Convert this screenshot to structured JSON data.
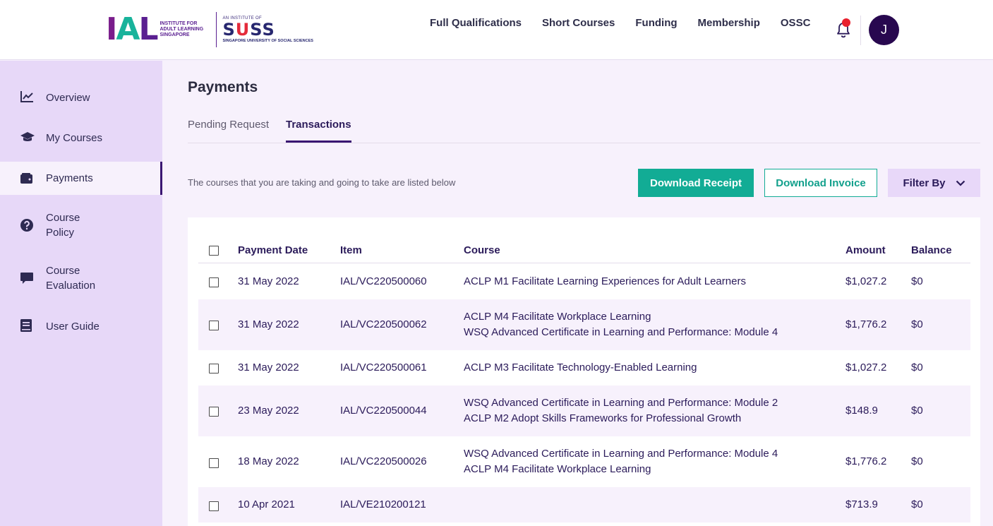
{
  "header": {
    "logo_ial_sub": "INSTITUTE FOR ADULT LEARNING SINGAPORE",
    "logo_suss_top": "AN INSTITUTE OF",
    "logo_suss_main_1": "S",
    "logo_suss_main_2": "U",
    "logo_suss_main_3": "SS",
    "logo_suss_bottom": "SINGAPORE UNIVERSITY OF SOCIAL SCIENCES",
    "nav": [
      "Full Qualifications",
      "Short Courses",
      "Funding",
      "Membership",
      "OSSC"
    ],
    "avatar_initial": "J"
  },
  "sidebar": {
    "items": [
      {
        "label": "Overview",
        "icon": "chart-line-icon"
      },
      {
        "label": "My Courses",
        "icon": "graduation-cap-icon"
      },
      {
        "label": "Payments",
        "icon": "wallet-icon",
        "active": true
      },
      {
        "label": "Course Policy",
        "label_1": "Course",
        "label_2": "Policy",
        "icon": "question-circle-icon"
      },
      {
        "label": "Course Evaluation",
        "label_1": "Course",
        "label_2": "Evaluation",
        "icon": "comment-icon"
      },
      {
        "label": "User Guide",
        "icon": "book-icon"
      }
    ]
  },
  "main": {
    "title": "Payments",
    "tabs": [
      {
        "label": "Pending Request",
        "active": false
      },
      {
        "label": "Transactions",
        "active": true
      }
    ],
    "description": "The courses that you are taking and going to take are listed below",
    "buttons": {
      "download_receipt": "Download Receipt",
      "download_invoice": "Download Invoice",
      "filter_by": "Filter By"
    },
    "table": {
      "columns": [
        "Payment Date",
        "Item",
        "Course",
        "Amount",
        "Balance"
      ],
      "rows": [
        {
          "date": "31 May 2022",
          "item": "IAL/VC220500060",
          "course": [
            "ACLP M1 Facilitate Learning Experiences for Adult Learners"
          ],
          "amount": "$1,027.2",
          "balance": "$0"
        },
        {
          "date": "31 May 2022",
          "item": "IAL/VC220500062",
          "course": [
            "ACLP M4 Facilitate Workplace Learning",
            "WSQ Advanced Certificate in Learning and Performance: Module 4"
          ],
          "amount": "$1,776.2",
          "balance": "$0"
        },
        {
          "date": "31 May 2022",
          "item": "IAL/VC220500061",
          "course": [
            "ACLP M3 Facilitate Technology-Enabled Learning"
          ],
          "amount": "$1,027.2",
          "balance": "$0"
        },
        {
          "date": "23 May 2022",
          "item": "IAL/VC220500044",
          "course": [
            "WSQ Advanced Certificate in Learning and Performance: Module 2",
            "ACLP M2 Adopt Skills Frameworks for Professional Growth"
          ],
          "amount": "$148.9",
          "balance": "$0"
        },
        {
          "date": "18 May 2022",
          "item": "IAL/VC220500026",
          "course": [
            "WSQ Advanced Certificate in Learning and Performance: Module 4",
            "ACLP M4 Facilitate Workplace Learning"
          ],
          "amount": "$1,776.2",
          "balance": "$0"
        },
        {
          "date": "10 Apr 2021",
          "item": "IAL/VE210200121",
          "course": [],
          "amount": "$713.9",
          "balance": "$0"
        }
      ]
    }
  },
  "colors": {
    "primary": "#3a1672",
    "accent_teal": "#12ac95",
    "sidebar_bg": "#e7d8f8",
    "page_bg": "#f7f1fc",
    "notification_dot": "#e8202e"
  }
}
